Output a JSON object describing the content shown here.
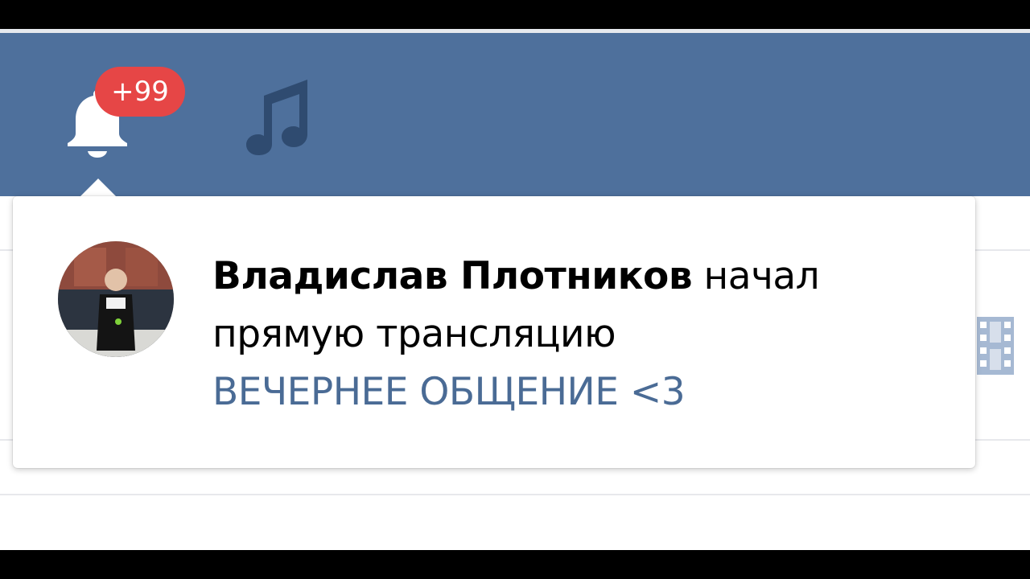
{
  "header": {
    "notifications": {
      "icon": "bell-icon",
      "badge": "+99",
      "badge_color": "#e64646"
    },
    "music": {
      "icon": "music-note-icon"
    },
    "bar_color": "#4e709c"
  },
  "notification": {
    "author": "Владислав Плотников",
    "action_line_1": "начал",
    "action_line_2": "прямую трансляцию",
    "stream_title": "ВЕЧЕРНЕЕ ОБЩЕНИЕ <3",
    "link_color": "#4a6b95"
  },
  "background": {
    "side_icon": "film-icon"
  }
}
